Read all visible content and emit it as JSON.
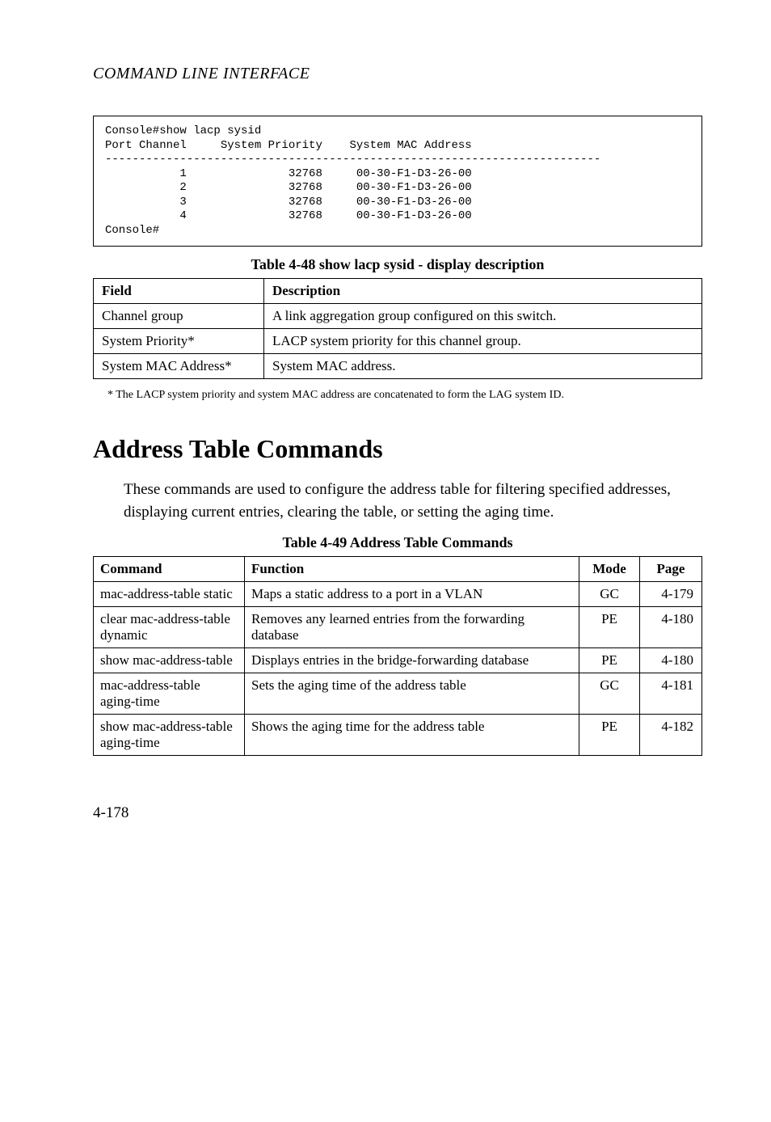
{
  "header": "COMMAND LINE INTERFACE",
  "console": "Console#show lacp sysid\nPort Channel     System Priority    System MAC Address\n-------------------------------------------------------------------------\n           1               32768     00-30-F1-D3-26-00\n           2               32768     00-30-F1-D3-26-00\n           3               32768     00-30-F1-D3-26-00\n           4               32768     00-30-F1-D3-26-00\nConsole#",
  "table48": {
    "caption": "Table 4-48  show lacp sysid - display description",
    "head": {
      "field": "Field",
      "desc": "Description"
    },
    "rows": [
      {
        "field": "Channel group",
        "desc": "A link aggregation group configured on this switch."
      },
      {
        "field": "System Priority*",
        "desc": "LACP system priority for this channel group."
      },
      {
        "field": "System MAC Address*",
        "desc": "System MAC address."
      }
    ],
    "footnote": "*  The LACP system priority and system MAC address are concatenated to form the LAG system ID."
  },
  "section": {
    "title": "Address Table Commands",
    "body": "These commands are used to configure the address table for filtering specified addresses, displaying current entries, clearing the table, or setting the aging time."
  },
  "table49": {
    "caption": "Table 4-49  Address Table Commands",
    "head": {
      "cmd": "Command",
      "func": "Function",
      "mode": "Mode",
      "page": "Page"
    },
    "rows": [
      {
        "cmd": "mac-address-table static",
        "func": "Maps a static address to a port in a VLAN",
        "mode": "GC",
        "page": "4-179"
      },
      {
        "cmd": "clear mac-address-table dynamic",
        "func": "Removes any learned entries from the forwarding database",
        "mode": "PE",
        "page": "4-180"
      },
      {
        "cmd": "show mac-address-table",
        "func": "Displays entries in the bridge-forwarding database",
        "mode": "PE",
        "page": "4-180"
      },
      {
        "cmd": "mac-address-table aging-time",
        "func": "Sets the aging time of the address table",
        "mode": "GC",
        "page": "4-181"
      },
      {
        "cmd": "show mac-address-table aging-time",
        "func": "Shows the aging time for the address table",
        "mode": "PE",
        "page": "4-182"
      }
    ]
  },
  "pageNumber": "4-178"
}
